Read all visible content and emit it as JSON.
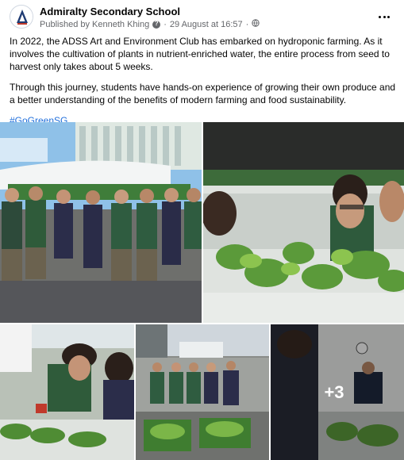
{
  "post": {
    "page_name": "Admiralty Secondary School",
    "published_by": "Published by Kenneth Khing",
    "separator": "·",
    "date": "29 August at 16:57",
    "privacy_icon": "globe-icon",
    "paragraphs": [
      "In 2022, the ADSS Art and Environment Club has embarked on hydroponic farming. As it involves the cultivation of plants in nutrient-enriched water, the entire process from seed to harvest only takes about 5 weeks.",
      "Through this journey, students have hands-on experience of growing their own produce and a better understanding of the benefits of modern farming and food sustainability."
    ],
    "hashtag": "#GoGreenSG"
  },
  "gallery": {
    "more_count": "+3"
  },
  "colors": {
    "link": "#216fdb",
    "meta": "#65676b",
    "text": "#050505"
  }
}
